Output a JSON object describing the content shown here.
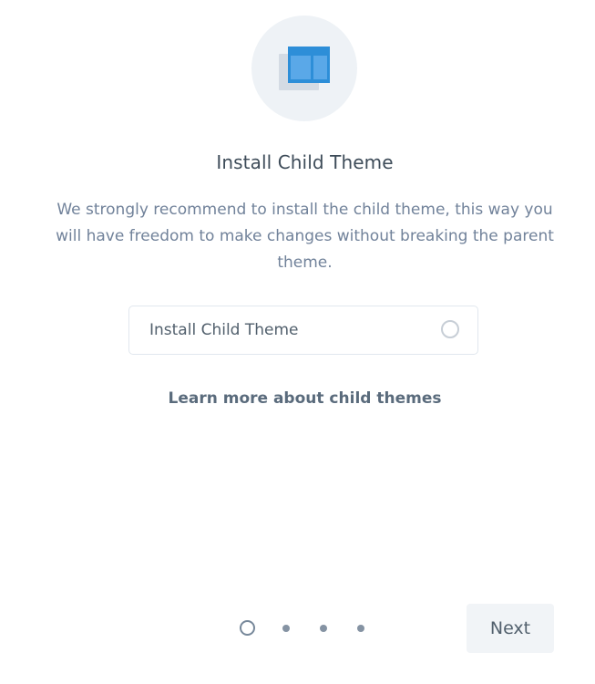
{
  "header": {
    "icon": "child-theme-window-icon",
    "title": "Install Child Theme"
  },
  "description": "We strongly recommend to install the child theme, this way you will have freedom to make changes without breaking the parent theme.",
  "option": {
    "label": "Install Child Theme",
    "selected": false
  },
  "learn_more": {
    "label": "Learn more about child themes"
  },
  "pagination": {
    "current_step": 1,
    "total_steps": 4
  },
  "footer": {
    "next_label": "Next"
  },
  "colors": {
    "title": "#3e4c59",
    "text": "#71829a",
    "icon_blue": "#2d8ed8",
    "icon_light_blue": "#5aa8e8",
    "icon_gray": "#d4dbe4",
    "icon_bg": "#eef2f6"
  }
}
